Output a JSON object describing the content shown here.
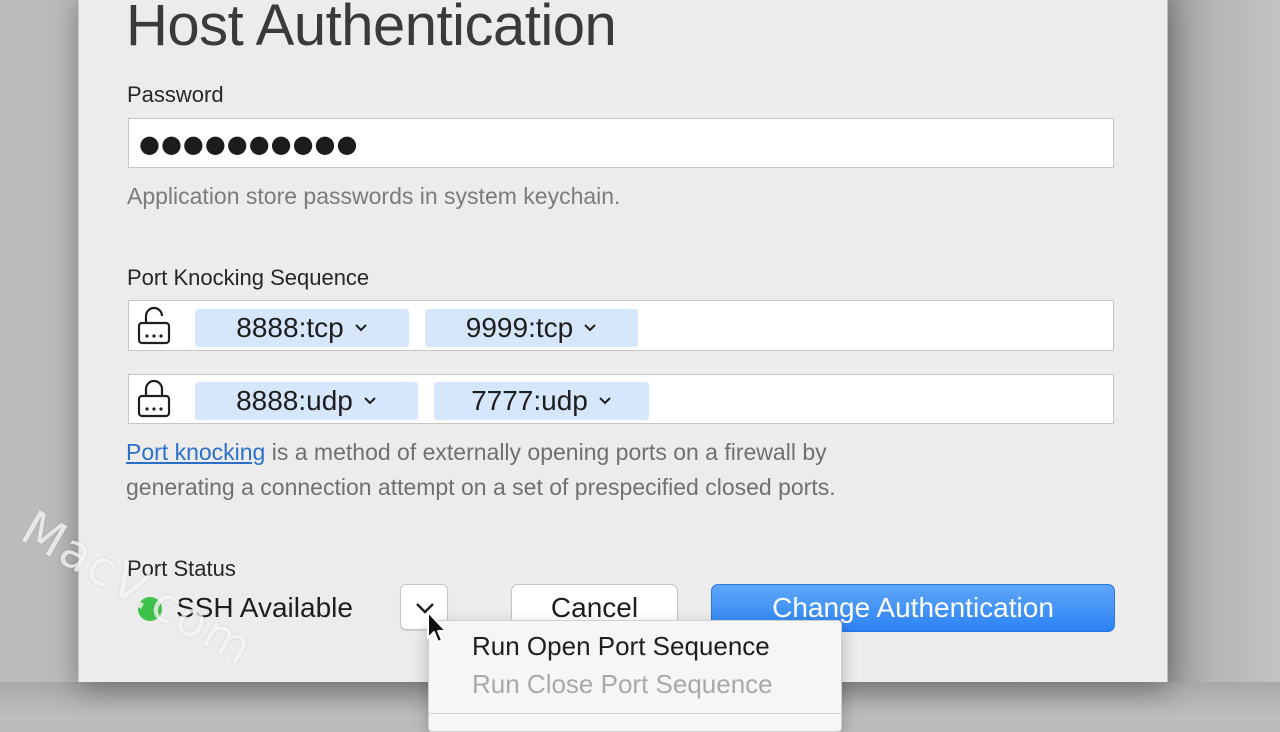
{
  "dialog": {
    "title": "Host Authentication",
    "password": {
      "label": "Password",
      "value": "●●●●●●●●●●",
      "hint": "Application store passwords in system keychain."
    },
    "port_knocking": {
      "label": "Port Knocking Sequence",
      "open_sequence": {
        "icon": "unlocked-lock-icon",
        "ports": [
          "8888:tcp",
          "9999:tcp"
        ]
      },
      "close_sequence": {
        "icon": "locked-lock-icon",
        "ports": [
          "8888:udp",
          "7777:udp"
        ]
      },
      "description_link": "Port knocking",
      "description_line1_rest": " is a method of externally opening ports on a firewall by",
      "description_line2": "generating a connection attempt on a set of prespecified closed ports."
    },
    "port_status": {
      "label": "Port Status",
      "status_text": "SSH Available",
      "status_color": "#3ec24a"
    },
    "buttons": {
      "cancel": "Cancel",
      "primary": "Change Authentication",
      "primary_color": "#2c83f4"
    },
    "menu": {
      "items": [
        {
          "label": "Run Open Port Sequence",
          "enabled": true
        },
        {
          "label": "Run Close Port Sequence",
          "enabled": false
        }
      ]
    }
  },
  "watermark": "MacV.com"
}
